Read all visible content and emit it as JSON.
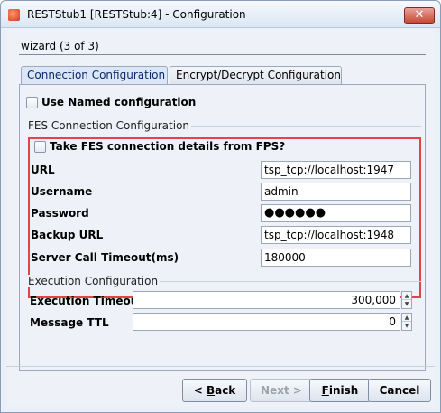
{
  "window": {
    "title": "RESTStub1 [RESTStub:4] - Configuration",
    "close_glyph": "✕"
  },
  "wizard": {
    "label": "wizard (3 of 3)"
  },
  "tabs": [
    {
      "label": "Connection Configuration",
      "active": true
    },
    {
      "label": "Encrypt/Decrypt Configuration",
      "active": false
    }
  ],
  "named_config": {
    "label": "Use Named configuration",
    "checked": false
  },
  "fes": {
    "group_title": "FES Connection Configuration",
    "take_from_fps_label": "Take FES connection details from FPS?",
    "take_from_fps_checked": false,
    "fields": [
      {
        "label": "URL",
        "value": "tsp_tcp://localhost:1947"
      },
      {
        "label": "Username",
        "value": "admin"
      },
      {
        "label": "Password",
        "value": "●●●●●●"
      },
      {
        "label": "Backup URL",
        "value": "tsp_tcp://localhost:1948"
      },
      {
        "label": "Server Call Timeout(ms)",
        "value": "180000"
      }
    ]
  },
  "execution": {
    "group_title": "Execution Configuration",
    "timeout_label": "Execution Timeout",
    "timeout_value": "300,000",
    "ttl_label": "Message TTL",
    "ttl_value": "0"
  },
  "buttons": {
    "back_prefix": "< ",
    "back_mnemonic": "B",
    "back_rest": "ack",
    "next": "Next >",
    "finish_mnemonic": "F",
    "finish_rest": "inish",
    "cancel": "Cancel"
  },
  "icons": {
    "app": "app-icon",
    "close": "close-icon",
    "spin_up": "▲",
    "spin_down": "▼"
  },
  "colors": {
    "highlight_border": "#e0454a",
    "close_button": "#c7422f"
  }
}
